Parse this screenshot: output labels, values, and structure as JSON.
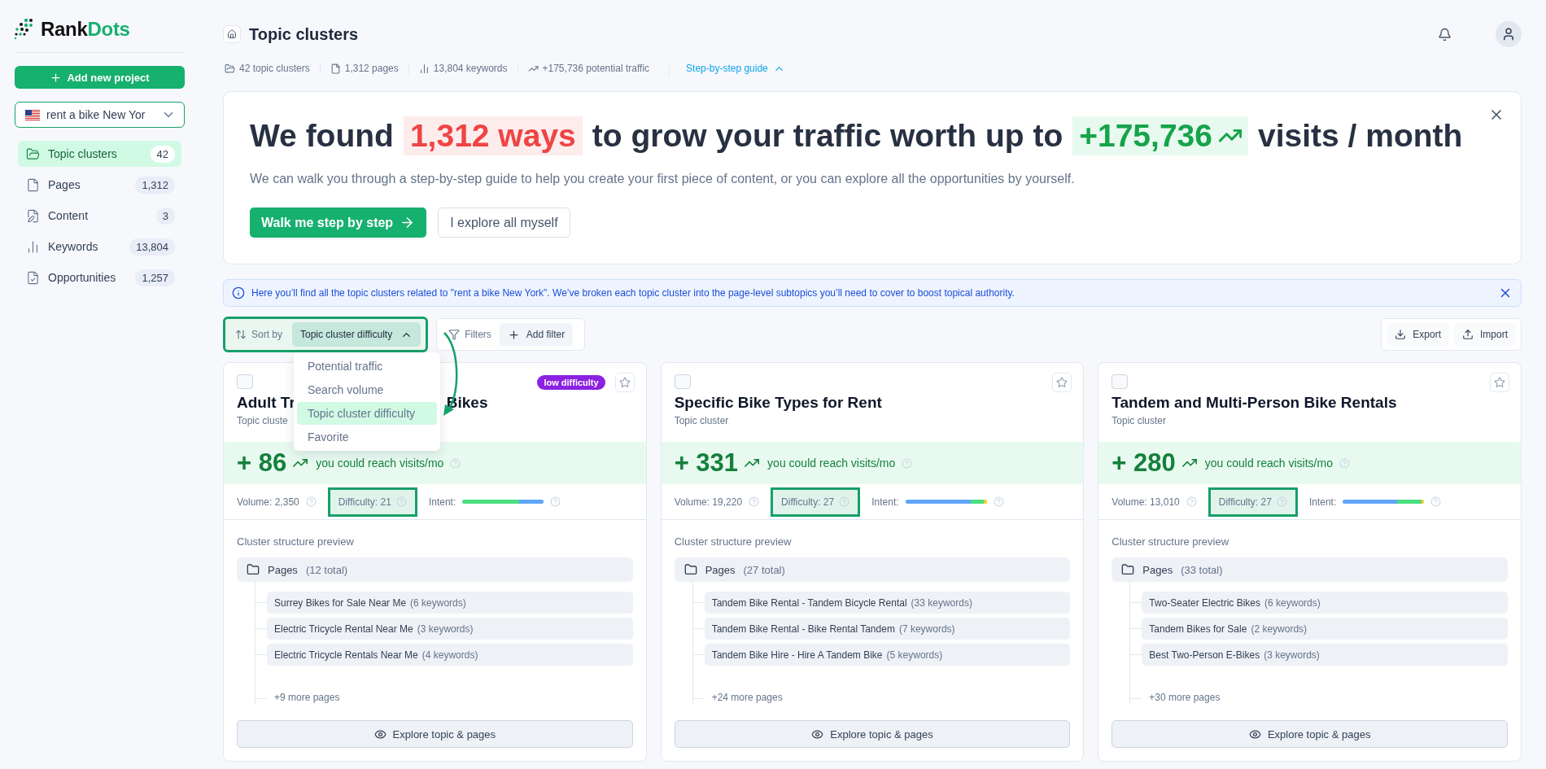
{
  "sidebar": {
    "logo": {
      "first": "Rank",
      "second": "Dots"
    },
    "add_button": "Add new project",
    "project": {
      "value": "rent a bike New Yor"
    },
    "items": [
      {
        "label": "Topic clusters",
        "count": "42",
        "selected": true
      },
      {
        "label": "Pages",
        "count": "1,312",
        "selected": false
      },
      {
        "label": "Content",
        "count": "3",
        "selected": false
      },
      {
        "label": "Keywords",
        "count": "13,804",
        "selected": false
      },
      {
        "label": "Opportunities",
        "count": "1,257",
        "selected": false
      }
    ]
  },
  "header": {
    "title": "Topic clusters",
    "stats": [
      "42 topic clusters",
      "1,312 pages",
      "13,804 keywords",
      "+175,736 potential traffic"
    ],
    "guide": {
      "label": "Step-by-step guide",
      "expanded": true
    }
  },
  "hero": {
    "headline": [
      {
        "kind": "text",
        "text": "We found"
      },
      {
        "kind": "negative",
        "text": "1,312 ways"
      },
      {
        "kind": "text",
        "text": "to grow your traffic worth up to"
      },
      {
        "kind": "positive",
        "text": "+175,736"
      },
      {
        "kind": "text",
        "text": "visits / month"
      }
    ],
    "subtitle": "We can walk you through a step-by-step guide to help you create your first piece of content, or you can explore all the opportunities by yourself.",
    "buttons": [
      {
        "label": "Walk me step by step",
        "kind": "primary"
      },
      {
        "label": "I explore all myself",
        "kind": "secondary"
      }
    ]
  },
  "notice": "Here you’ll find all the topic clusters related to \"rent a bike New York\". We’ve broken each topic cluster into the page-level subtopics you’ll need to cover to boost topical authority.",
  "toolbar": {
    "sort": {
      "label": "Sort by",
      "value": "Topic cluster difficulty",
      "expanded": true,
      "highlighted": true,
      "options": [
        {
          "label": "Potential traffic",
          "selected": false
        },
        {
          "label": "Search volume",
          "selected": false
        },
        {
          "label": "Topic cluster difficulty",
          "selected": true
        },
        {
          "label": "Favorite",
          "selected": false
        }
      ]
    },
    "filters": {
      "label": "Filters",
      "add": "Add filter"
    },
    "actions": [
      "Export",
      "Import"
    ]
  },
  "cards": [
    {
      "checked": false,
      "favorite": false,
      "badge": "low difficulty",
      "title_parts": [
        "Adult Tr",
        "Bikes"
      ],
      "subtitle": "Topic cluste",
      "traffic": "+ 86",
      "traffic_label": "you could reach visits/mo",
      "volume": "Volume: 2,350",
      "difficulty": {
        "text": "Difficulty: 21",
        "highlighted": true
      },
      "intent_label": "Intent:",
      "intent": [
        {
          "color": "#4ade80",
          "level": 0.7
        },
        {
          "color": "#60a5fa",
          "level": 0.3
        }
      ],
      "preview_label": "Cluster structure preview",
      "pages_label": "Pages",
      "pages_total": "(12 total)",
      "pages": [
        {
          "title": "Surrey Bikes for Sale Near Me",
          "keywords": "(6 keywords)"
        },
        {
          "title": "Electric Tricycle Rental Near Me",
          "keywords": "(3 keywords)"
        },
        {
          "title": "Electric Tricycle Rentals Near Me",
          "keywords": "(4 keywords)"
        }
      ],
      "more": "+9 more pages",
      "explore": "Explore topic & pages"
    },
    {
      "checked": false,
      "favorite": false,
      "title_parts": [
        "Specific Bike Types for Rent"
      ],
      "subtitle": "Topic cluster",
      "traffic": "+ 331",
      "traffic_label": "you could reach visits/mo",
      "volume": "Volume: 19,220",
      "difficulty": {
        "text": "Difficulty: 27",
        "highlighted": true
      },
      "intent_label": "Intent:",
      "intent": [
        {
          "color": "#60a5fa",
          "level": 0.8
        },
        {
          "color": "#4ade80",
          "level": 0.16
        },
        {
          "color": "#facc15",
          "level": 0.04
        }
      ],
      "preview_label": "Cluster structure preview",
      "pages_label": "Pages",
      "pages_total": "(27 total)",
      "pages": [
        {
          "title": "Tandem Bike Rental - Tandem Bicycle Rental",
          "keywords": "(33 keywords)"
        },
        {
          "title": "Tandem Bike Rental - Bike Rental Tandem",
          "keywords": "(7 keywords)"
        },
        {
          "title": "Tandem Bike Hire - Hire A Tandem Bike",
          "keywords": "(5 keywords)"
        }
      ],
      "more": "+24 more pages",
      "explore": "Explore topic & pages"
    },
    {
      "checked": false,
      "favorite": false,
      "title_parts": [
        "Tandem and Multi-Person Bike Rentals"
      ],
      "subtitle": "Topic cluster",
      "traffic": "+ 280",
      "traffic_label": "you could reach visits/mo",
      "volume": "Volume: 13,010",
      "difficulty": {
        "text": "Difficulty: 27",
        "highlighted": true
      },
      "intent_label": "Intent:",
      "intent": [
        {
          "color": "#60a5fa",
          "level": 0.67
        },
        {
          "color": "#4ade80",
          "level": 0.3
        },
        {
          "color": "#facc15",
          "level": 0.03
        }
      ],
      "preview_label": "Cluster structure preview",
      "pages_label": "Pages",
      "pages_total": "(33 total)",
      "pages": [
        {
          "title": "Two-Seater Electric Bikes",
          "keywords": "(6 keywords)"
        },
        {
          "title": "Tandem Bikes for Sale",
          "keywords": "(2 keywords)"
        },
        {
          "title": "Best Two-Person E-Bikes",
          "keywords": "(3 keywords)"
        }
      ],
      "more": "+30 more pages",
      "explore": "Explore topic & pages"
    }
  ]
}
